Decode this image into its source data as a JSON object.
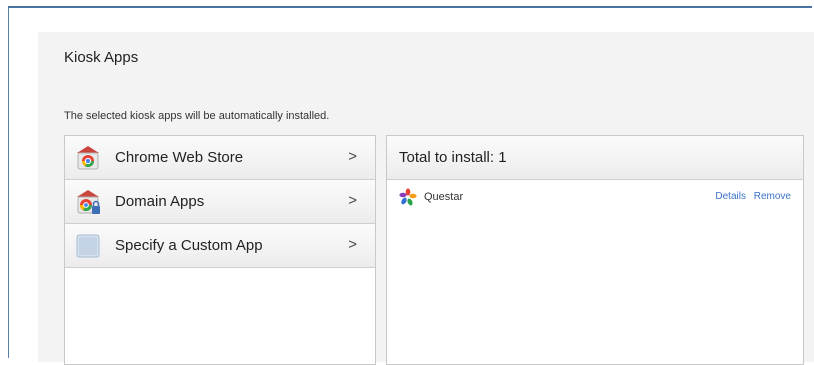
{
  "kiosk": {
    "title": "Kiosk Apps",
    "subtitle": "The selected kiosk apps will be automatically installed."
  },
  "sources": [
    {
      "label": "Chrome Web Store",
      "icon": "chrome-web-store-icon"
    },
    {
      "label": "Domain Apps",
      "icon": "domain-apps-icon"
    },
    {
      "label": "Specify a Custom App",
      "icon": "custom-app-icon"
    }
  ],
  "chevron": ">",
  "install_list": {
    "header": "Total to install: 1",
    "apps": [
      {
        "name": "Questar",
        "details_label": "Details",
        "remove_label": "Remove"
      }
    ]
  },
  "colors": {
    "frame_border": "#4a72a0",
    "link": "#3b73c8"
  }
}
